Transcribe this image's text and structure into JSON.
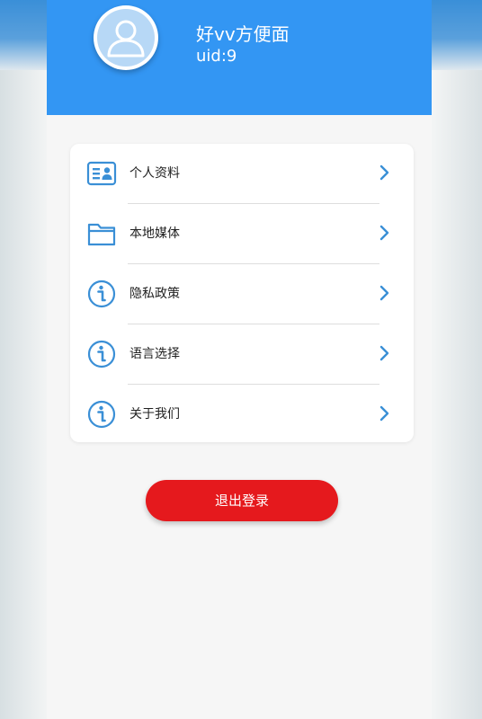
{
  "header": {
    "avatar_icon": "user-avatar-icon",
    "user_name": "好vv方便面",
    "uid_text": "uid:9"
  },
  "menu": {
    "items": [
      {
        "label": "个人资料",
        "icon": "id-card-icon"
      },
      {
        "label": "本地媒体",
        "icon": "folder-icon"
      },
      {
        "label": "隐私政策",
        "icon": "info-icon"
      },
      {
        "label": "语言选择",
        "icon": "info-icon"
      },
      {
        "label": "关于我们",
        "icon": "info-icon"
      }
    ],
    "chevron_icon": "chevron-right-icon"
  },
  "logout": {
    "label": "退出登录"
  },
  "colors": {
    "header_blue": "#3396f3",
    "icon_blue": "#3a8fd6",
    "logout_red": "#e5191d",
    "page_background": "#f6f6f6"
  }
}
